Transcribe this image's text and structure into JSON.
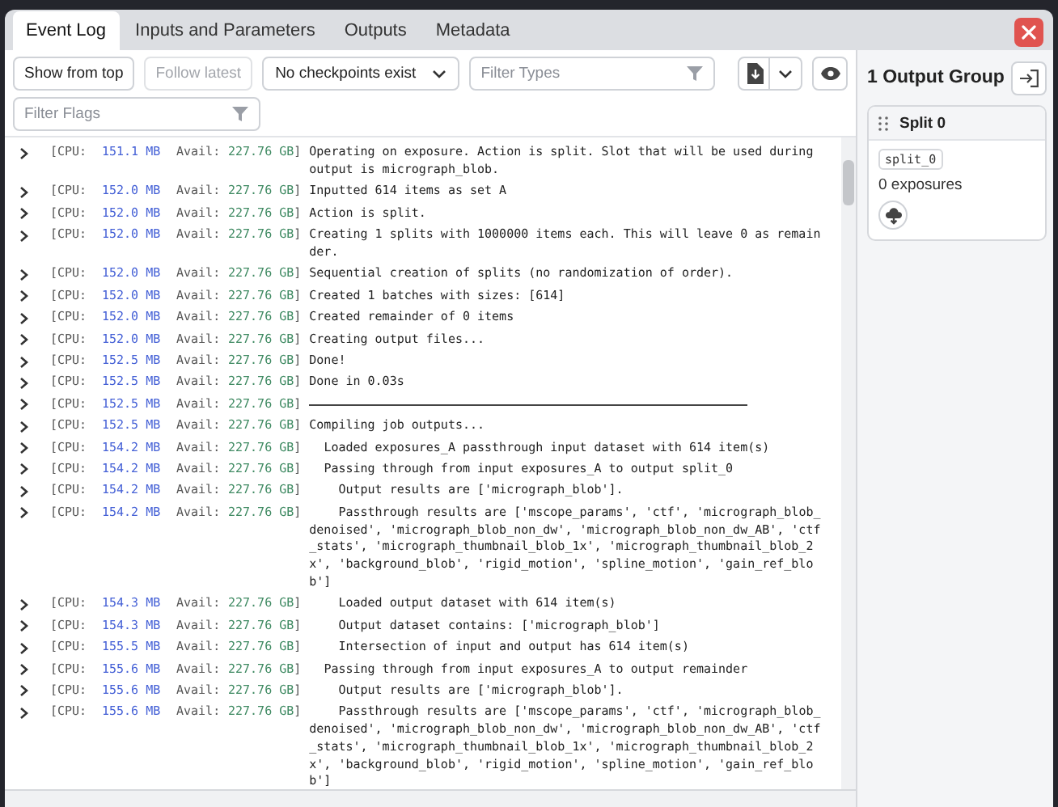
{
  "tabs": [
    {
      "label": "Event Log",
      "selected": true
    },
    {
      "label": "Inputs and Parameters",
      "selected": false
    },
    {
      "label": "Outputs",
      "selected": false
    },
    {
      "label": "Metadata",
      "selected": false
    }
  ],
  "toolbar": {
    "show_from_top": {
      "label": "Show from top",
      "disabled": false
    },
    "follow_latest": {
      "label": "Follow latest",
      "disabled": true
    },
    "checkpoints": {
      "value": "No checkpoints exist"
    },
    "filter_types": {
      "placeholder": "Filter Types"
    },
    "filter_flags": {
      "placeholder": "Filter Flags"
    }
  },
  "log": [
    {
      "kind": "text",
      "cpu": "[CPU:",
      "memory": "151.1 MB",
      "avail_label": "Avail:",
      "avail": "227.76 GB",
      "bracket": "]",
      "message": "Operating on exposure. Action is split. Slot that will be used during output is micrograph_blob."
    },
    {
      "kind": "text",
      "cpu": "[CPU:",
      "memory": "152.0 MB",
      "avail_label": "Avail:",
      "avail": "227.76 GB",
      "bracket": "]",
      "message": "Inputted 614 items as set A"
    },
    {
      "kind": "text",
      "cpu": "[CPU:",
      "memory": "152.0 MB",
      "avail_label": "Avail:",
      "avail": "227.76 GB",
      "bracket": "]",
      "message": "Action is split."
    },
    {
      "kind": "text",
      "cpu": "[CPU:",
      "memory": "152.0 MB",
      "avail_label": "Avail:",
      "avail": "227.76 GB",
      "bracket": "]",
      "message": "Creating 1 splits with 1000000 items each. This will leave 0 as remainder."
    },
    {
      "kind": "text",
      "cpu": "[CPU:",
      "memory": "152.0 MB",
      "avail_label": "Avail:",
      "avail": "227.76 GB",
      "bracket": "]",
      "message": "Sequential creation of splits (no randomization of order)."
    },
    {
      "kind": "text",
      "cpu": "[CPU:",
      "memory": "152.0 MB",
      "avail_label": "Avail:",
      "avail": "227.76 GB",
      "bracket": "]",
      "message": "Created 1 batches with sizes: [614]"
    },
    {
      "kind": "text",
      "cpu": "[CPU:",
      "memory": "152.0 MB",
      "avail_label": "Avail:",
      "avail": "227.76 GB",
      "bracket": "]",
      "message": "Created remainder of 0 items"
    },
    {
      "kind": "text",
      "cpu": "[CPU:",
      "memory": "152.0 MB",
      "avail_label": "Avail:",
      "avail": "227.76 GB",
      "bracket": "]",
      "message": "Creating output files..."
    },
    {
      "kind": "text",
      "cpu": "[CPU:",
      "memory": "152.5 MB",
      "avail_label": "Avail:",
      "avail": "227.76 GB",
      "bracket": "]",
      "message": "Done!"
    },
    {
      "kind": "text",
      "cpu": "[CPU:",
      "memory": "152.5 MB",
      "avail_label": "Avail:",
      "avail": "227.76 GB",
      "bracket": "]",
      "message": "Done in 0.03s"
    },
    {
      "kind": "rule",
      "cpu": "[CPU:",
      "memory": "152.5 MB",
      "avail_label": "Avail:",
      "avail": "227.76 GB",
      "bracket": "]"
    },
    {
      "kind": "text",
      "cpu": "[CPU:",
      "memory": "152.5 MB",
      "avail_label": "Avail:",
      "avail": "227.76 GB",
      "bracket": "]",
      "message": "Compiling job outputs..."
    },
    {
      "kind": "text",
      "cpu": "[CPU:",
      "memory": "154.2 MB",
      "avail_label": "Avail:",
      "avail": "227.76 GB",
      "bracket": "]",
      "message": "  Loaded exposures_A passthrough input dataset with 614 item(s)"
    },
    {
      "kind": "text",
      "cpu": "[CPU:",
      "memory": "154.2 MB",
      "avail_label": "Avail:",
      "avail": "227.76 GB",
      "bracket": "]",
      "message": "  Passing through from input exposures_A to output split_0"
    },
    {
      "kind": "text",
      "cpu": "[CPU:",
      "memory": "154.2 MB",
      "avail_label": "Avail:",
      "avail": "227.76 GB",
      "bracket": "]",
      "message": "    Output results are ['micrograph_blob']."
    },
    {
      "kind": "text",
      "cpu": "[CPU:",
      "memory": "154.2 MB",
      "avail_label": "Avail:",
      "avail": "227.76 GB",
      "bracket": "]",
      "message": "    Passthrough results are ['mscope_params', 'ctf', 'micrograph_blob_denoised', 'micrograph_blob_non_dw', 'micrograph_blob_non_dw_AB', 'ctf_stats', 'micrograph_thumbnail_blob_1x', 'micrograph_thumbnail_blob_2x', 'background_blob', 'rigid_motion', 'spline_motion', 'gain_ref_blob']"
    },
    {
      "kind": "text",
      "cpu": "[CPU:",
      "memory": "154.3 MB",
      "avail_label": "Avail:",
      "avail": "227.76 GB",
      "bracket": "]",
      "message": "    Loaded output dataset with 614 item(s)"
    },
    {
      "kind": "text",
      "cpu": "[CPU:",
      "memory": "154.3 MB",
      "avail_label": "Avail:",
      "avail": "227.76 GB",
      "bracket": "]",
      "message": "    Output dataset contains: ['micrograph_blob']"
    },
    {
      "kind": "text",
      "cpu": "[CPU:",
      "memory": "155.5 MB",
      "avail_label": "Avail:",
      "avail": "227.76 GB",
      "bracket": "]",
      "message": "    Intersection of input and output has 614 item(s)"
    },
    {
      "kind": "text",
      "cpu": "[CPU:",
      "memory": "155.6 MB",
      "avail_label": "Avail:",
      "avail": "227.76 GB",
      "bracket": "]",
      "message": "  Passing through from input exposures_A to output remainder"
    },
    {
      "kind": "text",
      "cpu": "[CPU:",
      "memory": "155.6 MB",
      "avail_label": "Avail:",
      "avail": "227.76 GB",
      "bracket": "]",
      "message": "    Output results are ['micrograph_blob']."
    },
    {
      "kind": "text",
      "cpu": "[CPU:",
      "memory": "155.6 MB",
      "avail_label": "Avail:",
      "avail": "227.76 GB",
      "bracket": "]",
      "message": "    Passthrough results are ['mscope_params', 'ctf', 'micrograph_blob_denoised', 'micrograph_blob_non_dw', 'micrograph_blob_non_dw_AB', 'ctf_stats', 'micrograph_thumbnail_blob_1x', 'micrograph_thumbnail_blob_2x', 'background_blob', 'rigid_motion', 'spline_motion', 'gain_ref_blob']"
    }
  ],
  "output_panel": {
    "title": "1 Output Group",
    "groups": [
      {
        "name": "Split 0",
        "slot": "split_0",
        "count": "0 exposures"
      }
    ]
  }
}
